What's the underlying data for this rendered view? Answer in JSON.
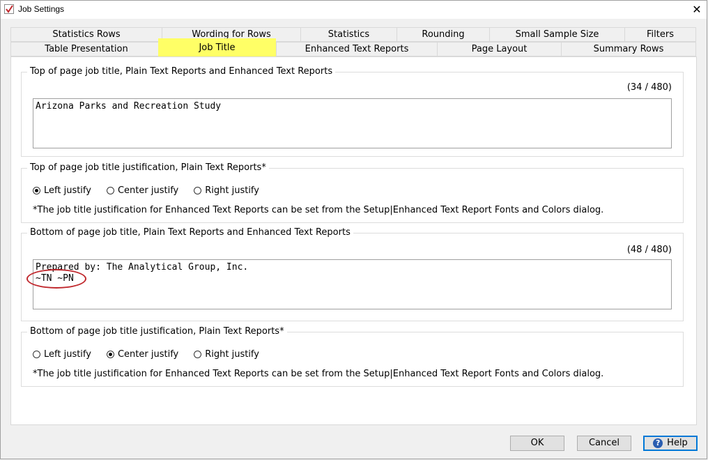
{
  "window": {
    "title": "Job Settings"
  },
  "colors": {
    "highlight": "#ffff66",
    "annotation": "#c0282d",
    "accent": "#0078d7"
  },
  "tabs": {
    "row1": [
      {
        "label": "Statistics Rows"
      },
      {
        "label": "Wording for Rows"
      },
      {
        "label": "Statistics"
      },
      {
        "label": "Rounding"
      },
      {
        "label": "Small Sample Size"
      },
      {
        "label": "Filters"
      }
    ],
    "row2": [
      {
        "label": "Table Presentation"
      },
      {
        "label": "Job Title",
        "active": true
      },
      {
        "label": "Enhanced Text Reports"
      },
      {
        "label": "Page Layout"
      },
      {
        "label": "Summary Rows"
      }
    ]
  },
  "top_title": {
    "legend": "Top of page job title, Plain Text Reports and Enhanced Text Reports",
    "counter": "(34 / 480)",
    "value": "Arizona Parks and Recreation Study"
  },
  "top_just": {
    "legend": "Top of page job title justification, Plain Text Reports*",
    "options": [
      "Left justify",
      "Center justify",
      "Right justify"
    ],
    "selected": "Left justify",
    "note": "*The job title justification for Enhanced Text Reports can be set from the Setup|Enhanced Text Report Fonts and Colors dialog."
  },
  "bottom_title": {
    "legend": "Bottom of page job title, Plain Text Reports and Enhanced Text Reports",
    "counter": "(48 / 480)",
    "line1": "Prepared by: The Analytical Group, Inc.",
    "line2": "~TN ~PN"
  },
  "bottom_just": {
    "legend": "Bottom of page job title justification, Plain Text Reports*",
    "options": [
      "Left justify",
      "Center justify",
      "Right justify"
    ],
    "selected": "Center justify",
    "note": "*The job title justification for Enhanced Text Reports can be set from the Setup|Enhanced Text Report Fonts and Colors dialog."
  },
  "buttons": {
    "ok": "OK",
    "cancel": "Cancel",
    "help": "Help"
  }
}
